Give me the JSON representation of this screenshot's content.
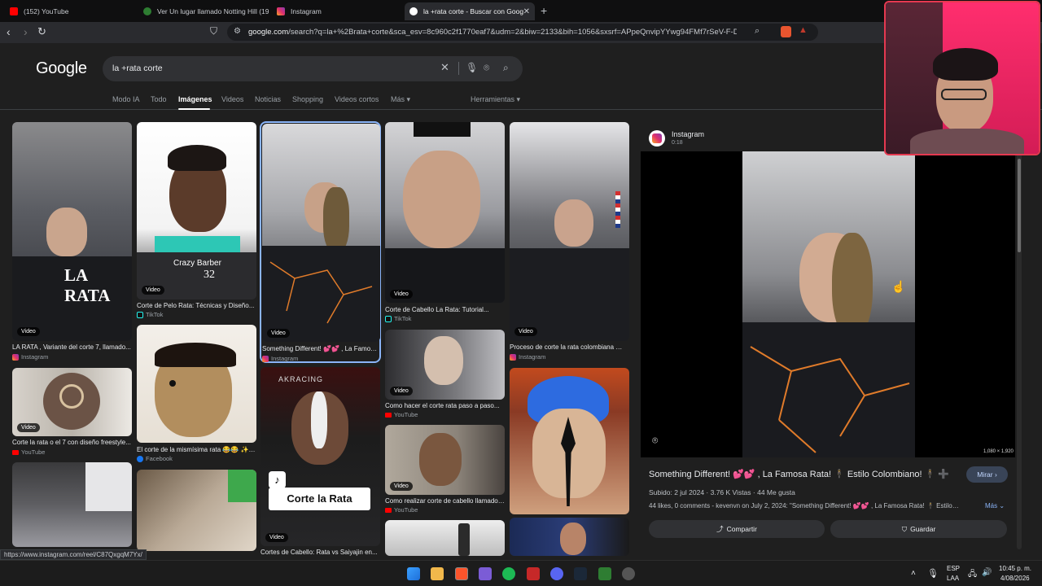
{
  "browser": {
    "tabs": [
      {
        "title": "(152) YouTube",
        "favicon_color": "#ff0000"
      },
      {
        "title": "Ver Un lugar llamado Notting Hill (19…",
        "favicon_color": "#2e7d32"
      },
      {
        "title": "Instagram",
        "favicon_color": "#e1306c"
      },
      {
        "title": "la +rata corte - Buscar con Goog",
        "favicon_color": "#ffffff"
      }
    ],
    "new_tab": "+",
    "url_host": "google.com",
    "url_rest": "/search?q=la+%2Brata+corte&sca_esv=8c960c2f1770eaf7&udm=2&biw=2133&bih=1056&sxsrf=APpeQnvipYYwg94FMf7rSeV-F-DhGz…"
  },
  "google": {
    "logo": "Google",
    "query": "la +rata corte",
    "tabs": [
      "Modo IA",
      "Todo",
      "Imágenes",
      "Videos",
      "Noticias",
      "Shopping",
      "Videos cortos",
      "Más ▾"
    ],
    "tools": "Herramientas ▾"
  },
  "video_badge": "Video",
  "results": [
    {
      "title": "LA RATA , Variante del corte 7, llamado...",
      "source": "Instagram",
      "overlay": "LA RATA"
    },
    {
      "title": "Corte la rata o el 7 con diseño freestyle...",
      "source": "YouTube"
    },
    {
      "title": "Corte de Pelo Rata: Técnicas y Diseño...",
      "source": "TikTok",
      "overlay": "Crazy Barber",
      "overlay2": "32"
    },
    {
      "title": "El corte de la mismísima rata 😂😂 ✨…",
      "source": "Facebook"
    },
    {
      "title": "Something Different! 💕💕 , La Famosa...",
      "source": "Instagram"
    },
    {
      "title": "Cortes de Cabello: Rata vs Saiyajin en...",
      "source": "TikTok",
      "overlay": "Corte la Rata",
      "overlay2": "AKRACING"
    },
    {
      "title": "Corte de Cabello La Rata: Tutorial...",
      "source": "TikTok"
    },
    {
      "title": "Como hacer el corte rata paso a paso...",
      "source": "YouTube"
    },
    {
      "title": "Como realizar corte de cabello llamado ...",
      "source": "YouTube"
    },
    {
      "title": "Proceso de corte la rata colombiana 💕 ...",
      "source": "Instagram"
    }
  ],
  "preview": {
    "source": "Instagram",
    "duration": "0:18",
    "resolution": "1,080 × 1,920",
    "title": "Something Different! 💕💕 , La Famosa Rata! 🕴 Estilo Colombiano! 🕴 ➕",
    "watch_label": "Mirar ›",
    "meta": "Subido: 2 jul 2024 · 3.76 K Vistas · 44 Me gusta",
    "description": "44 likes, 0 comments - kevenvn on July 2, 2024: \"Something Different! 💕💕 , La Famosa Rata! 🕴 Estilo…",
    "more_label": "Más ⌄",
    "share_label": "Compartir",
    "save_label": "Guardar"
  },
  "status_url": "https://www.instagram.com/reel/C87QxgqM7Yx/",
  "taskbar": {
    "lang1": "ESP",
    "lang2": "LAA",
    "time": "10:45 p. m.",
    "date": "4/08/2026"
  },
  "colors": {
    "accent_blue": "#8ab4f8",
    "watch_button_bg": "#394457",
    "action_button_bg": "#303134",
    "cam_border": "#e53950"
  }
}
